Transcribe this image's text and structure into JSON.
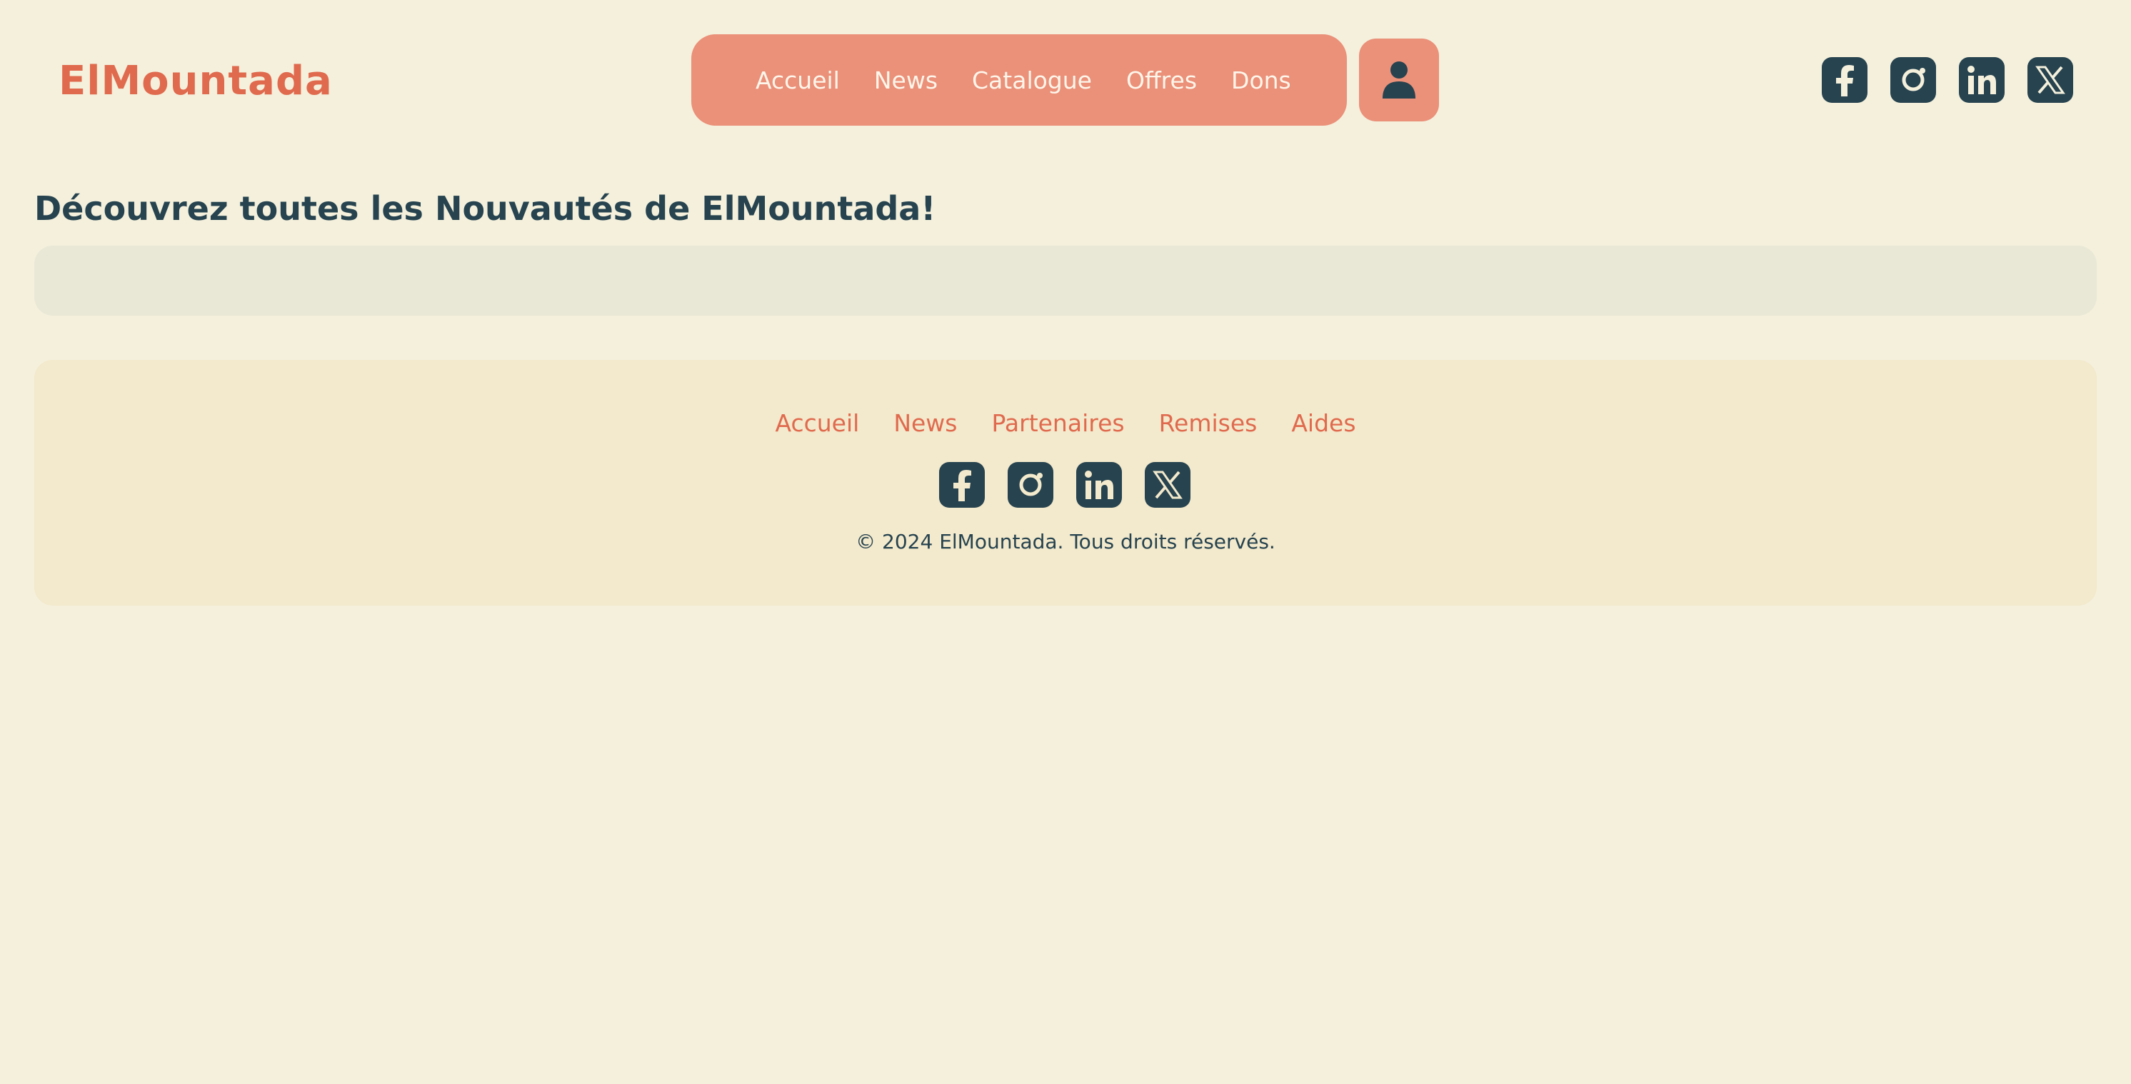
{
  "header": {
    "logo": "ElMountada",
    "nav": [
      "Accueil",
      "News",
      "Catalogue",
      "Offres",
      "Dons"
    ],
    "user_icon": "user-icon",
    "social": [
      "facebook-icon",
      "instagram-icon",
      "linkedin-icon",
      "x-icon"
    ]
  },
  "main": {
    "title": "Découvrez toutes les Nouvautés de ElMountada!"
  },
  "footer": {
    "links": [
      "Accueil",
      "News",
      "Partenaires",
      "Remises",
      "Aides"
    ],
    "social": [
      "facebook-icon",
      "instagram-icon",
      "linkedin-icon",
      "x-icon"
    ],
    "copyright": "© 2024 ElMountada. Tous droits réservés."
  },
  "colors": {
    "background": "#f4f0dc",
    "accent": "#e06a4e",
    "nav_pill": "#eb9079",
    "dark": "#26434f",
    "news_box": "#e9e8d6",
    "footer": "#f3e9cc"
  }
}
